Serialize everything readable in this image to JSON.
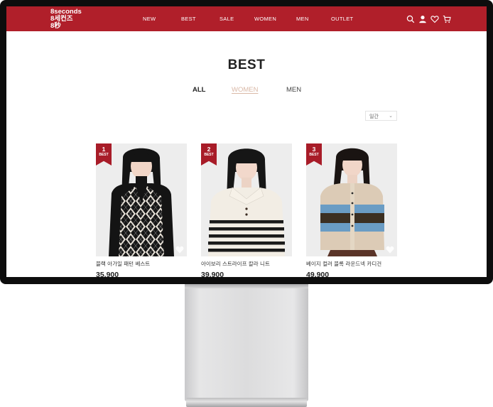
{
  "header": {
    "logo_lines": [
      "8seconds",
      "8세컨즈",
      "8秒"
    ],
    "nav": [
      "NEW",
      "BEST",
      "SALE",
      "WOMEN",
      "MEN",
      "OUTLET"
    ],
    "icons": [
      "search-icon",
      "user-icon",
      "heart-icon",
      "cart-icon"
    ],
    "brand_color": "#b01f2a"
  },
  "page": {
    "title": "BEST",
    "tabs": [
      "ALL",
      "WOMEN",
      "MEN"
    ],
    "active_tab": "ALL",
    "hovered_tab": "WOMEN",
    "period_select": "일간"
  },
  "products": [
    {
      "rank": "1",
      "badge": "BEST",
      "name": "블랙 아가일 패턴 베스트",
      "price": "35,900"
    },
    {
      "rank": "2",
      "badge": "BEST",
      "name": "아이보리 스트라이프 칼라 니트",
      "price": "39,900"
    },
    {
      "rank": "3",
      "badge": "BEST",
      "name": "베이지 컬러 블록 라운드넥 카디건",
      "price": "49,900"
    }
  ]
}
